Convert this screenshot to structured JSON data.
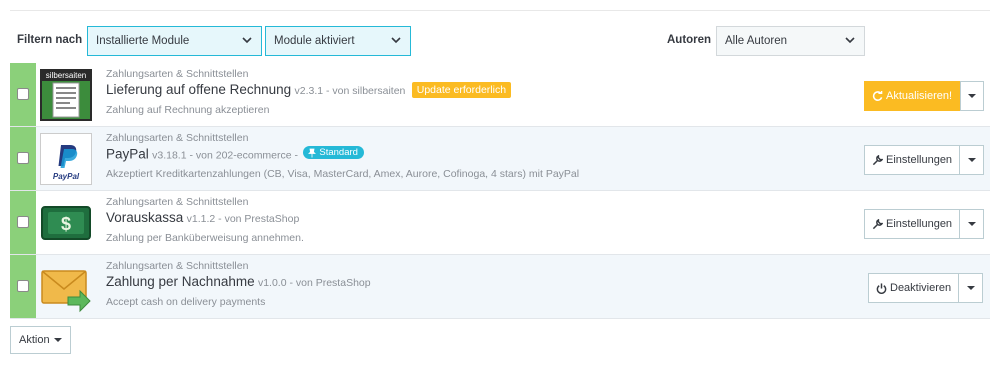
{
  "filter": {
    "label": "Filtern nach",
    "module_select": "Installierte Module",
    "status_select": "Module aktiviert",
    "authors_label": "Autoren",
    "authors_select": "Alle Autoren"
  },
  "modules": [
    {
      "category": "Zahlungsarten & Schnittstellen",
      "name": "Lieferung auf offene Rechnung",
      "version": "v2.3.1 - von silbersaiten",
      "badge": "Update erforderlich",
      "description": "Zahlung auf Rechnung akzeptieren",
      "logo_text": "silbersaiten",
      "button": "Aktualisieren!"
    },
    {
      "category": "Zahlungsarten & Schnittstellen",
      "name": "PayPal",
      "version": "v3.18.1 - von 202-ecommerce -",
      "badge": "Standard",
      "description": "Akzeptiert Kreditkartenzahlungen (CB, Visa, MasterCard, Amex, Aurore, Cofinoga, 4 stars) mit PayPal",
      "logo_text": "PayPal",
      "button": "Einstellungen"
    },
    {
      "category": "Zahlungsarten & Schnittstellen",
      "name": "Vorauskassa",
      "version": "v1.1.2 - von PrestaShop",
      "description": "Zahlung per Banküberweisung annehmen.",
      "logo_text": "$",
      "button": "Einstellungen"
    },
    {
      "category": "Zahlungsarten & Schnittstellen",
      "name": "Zahlung per Nachnahme",
      "version": "v1.0.0 - von PrestaShop",
      "description": "Accept cash on delivery payments",
      "button": "Deaktivieren"
    }
  ],
  "bulk_action": "Aktion",
  "colors": {
    "accent": "#25b9d7",
    "warning": "#fbbb22",
    "enabled": "#8bd07a"
  }
}
